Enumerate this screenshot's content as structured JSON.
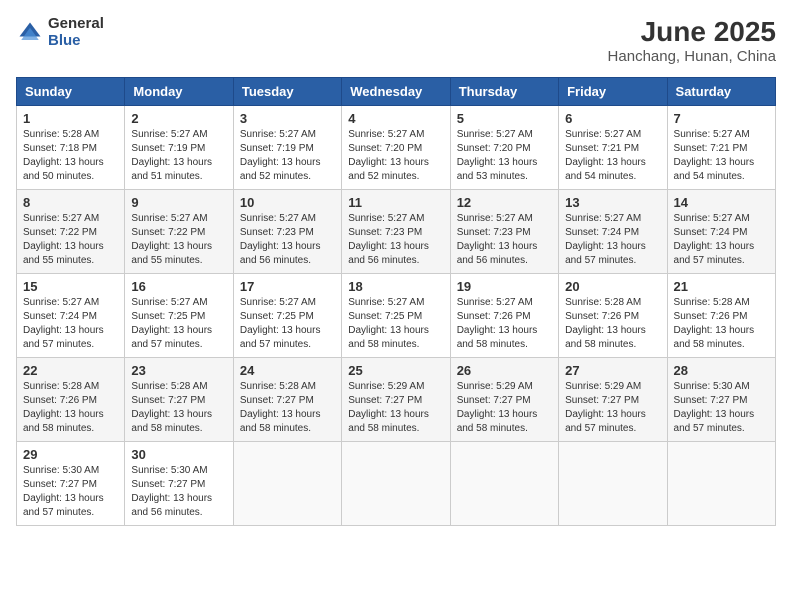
{
  "logo": {
    "general": "General",
    "blue": "Blue"
  },
  "header": {
    "title": "June 2025",
    "subtitle": "Hanchang, Hunan, China"
  },
  "weekdays": [
    "Sunday",
    "Monday",
    "Tuesday",
    "Wednesday",
    "Thursday",
    "Friday",
    "Saturday"
  ],
  "weeks": [
    [
      {
        "day": "1",
        "sunrise": "5:28 AM",
        "sunset": "7:18 PM",
        "daylight": "13 hours and 50 minutes."
      },
      {
        "day": "2",
        "sunrise": "5:27 AM",
        "sunset": "7:19 PM",
        "daylight": "13 hours and 51 minutes."
      },
      {
        "day": "3",
        "sunrise": "5:27 AM",
        "sunset": "7:19 PM",
        "daylight": "13 hours and 52 minutes."
      },
      {
        "day": "4",
        "sunrise": "5:27 AM",
        "sunset": "7:20 PM",
        "daylight": "13 hours and 52 minutes."
      },
      {
        "day": "5",
        "sunrise": "5:27 AM",
        "sunset": "7:20 PM",
        "daylight": "13 hours and 53 minutes."
      },
      {
        "day": "6",
        "sunrise": "5:27 AM",
        "sunset": "7:21 PM",
        "daylight": "13 hours and 54 minutes."
      },
      {
        "day": "7",
        "sunrise": "5:27 AM",
        "sunset": "7:21 PM",
        "daylight": "13 hours and 54 minutes."
      }
    ],
    [
      {
        "day": "8",
        "sunrise": "5:27 AM",
        "sunset": "7:22 PM",
        "daylight": "13 hours and 55 minutes."
      },
      {
        "day": "9",
        "sunrise": "5:27 AM",
        "sunset": "7:22 PM",
        "daylight": "13 hours and 55 minutes."
      },
      {
        "day": "10",
        "sunrise": "5:27 AM",
        "sunset": "7:23 PM",
        "daylight": "13 hours and 56 minutes."
      },
      {
        "day": "11",
        "sunrise": "5:27 AM",
        "sunset": "7:23 PM",
        "daylight": "13 hours and 56 minutes."
      },
      {
        "day": "12",
        "sunrise": "5:27 AM",
        "sunset": "7:23 PM",
        "daylight": "13 hours and 56 minutes."
      },
      {
        "day": "13",
        "sunrise": "5:27 AM",
        "sunset": "7:24 PM",
        "daylight": "13 hours and 57 minutes."
      },
      {
        "day": "14",
        "sunrise": "5:27 AM",
        "sunset": "7:24 PM",
        "daylight": "13 hours and 57 minutes."
      }
    ],
    [
      {
        "day": "15",
        "sunrise": "5:27 AM",
        "sunset": "7:24 PM",
        "daylight": "13 hours and 57 minutes."
      },
      {
        "day": "16",
        "sunrise": "5:27 AM",
        "sunset": "7:25 PM",
        "daylight": "13 hours and 57 minutes."
      },
      {
        "day": "17",
        "sunrise": "5:27 AM",
        "sunset": "7:25 PM",
        "daylight": "13 hours and 57 minutes."
      },
      {
        "day": "18",
        "sunrise": "5:27 AM",
        "sunset": "7:25 PM",
        "daylight": "13 hours and 58 minutes."
      },
      {
        "day": "19",
        "sunrise": "5:27 AM",
        "sunset": "7:26 PM",
        "daylight": "13 hours and 58 minutes."
      },
      {
        "day": "20",
        "sunrise": "5:28 AM",
        "sunset": "7:26 PM",
        "daylight": "13 hours and 58 minutes."
      },
      {
        "day": "21",
        "sunrise": "5:28 AM",
        "sunset": "7:26 PM",
        "daylight": "13 hours and 58 minutes."
      }
    ],
    [
      {
        "day": "22",
        "sunrise": "5:28 AM",
        "sunset": "7:26 PM",
        "daylight": "13 hours and 58 minutes."
      },
      {
        "day": "23",
        "sunrise": "5:28 AM",
        "sunset": "7:27 PM",
        "daylight": "13 hours and 58 minutes."
      },
      {
        "day": "24",
        "sunrise": "5:28 AM",
        "sunset": "7:27 PM",
        "daylight": "13 hours and 58 minutes."
      },
      {
        "day": "25",
        "sunrise": "5:29 AM",
        "sunset": "7:27 PM",
        "daylight": "13 hours and 58 minutes."
      },
      {
        "day": "26",
        "sunrise": "5:29 AM",
        "sunset": "7:27 PM",
        "daylight": "13 hours and 58 minutes."
      },
      {
        "day": "27",
        "sunrise": "5:29 AM",
        "sunset": "7:27 PM",
        "daylight": "13 hours and 57 minutes."
      },
      {
        "day": "28",
        "sunrise": "5:30 AM",
        "sunset": "7:27 PM",
        "daylight": "13 hours and 57 minutes."
      }
    ],
    [
      {
        "day": "29",
        "sunrise": "5:30 AM",
        "sunset": "7:27 PM",
        "daylight": "13 hours and 57 minutes."
      },
      {
        "day": "30",
        "sunrise": "5:30 AM",
        "sunset": "7:27 PM",
        "daylight": "13 hours and 56 minutes."
      },
      null,
      null,
      null,
      null,
      null
    ]
  ]
}
